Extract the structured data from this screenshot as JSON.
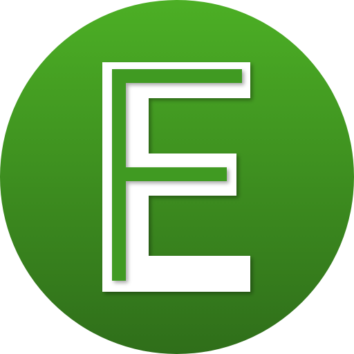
{
  "logo": {
    "icon": "letter-e-logo-icon",
    "letter": "E",
    "colors": {
      "circle_top": "#4caf25",
      "circle_bottom": "#2f6e1a",
      "letter_fill": "#ffffff",
      "letter_inner": "#3f9a22"
    }
  }
}
